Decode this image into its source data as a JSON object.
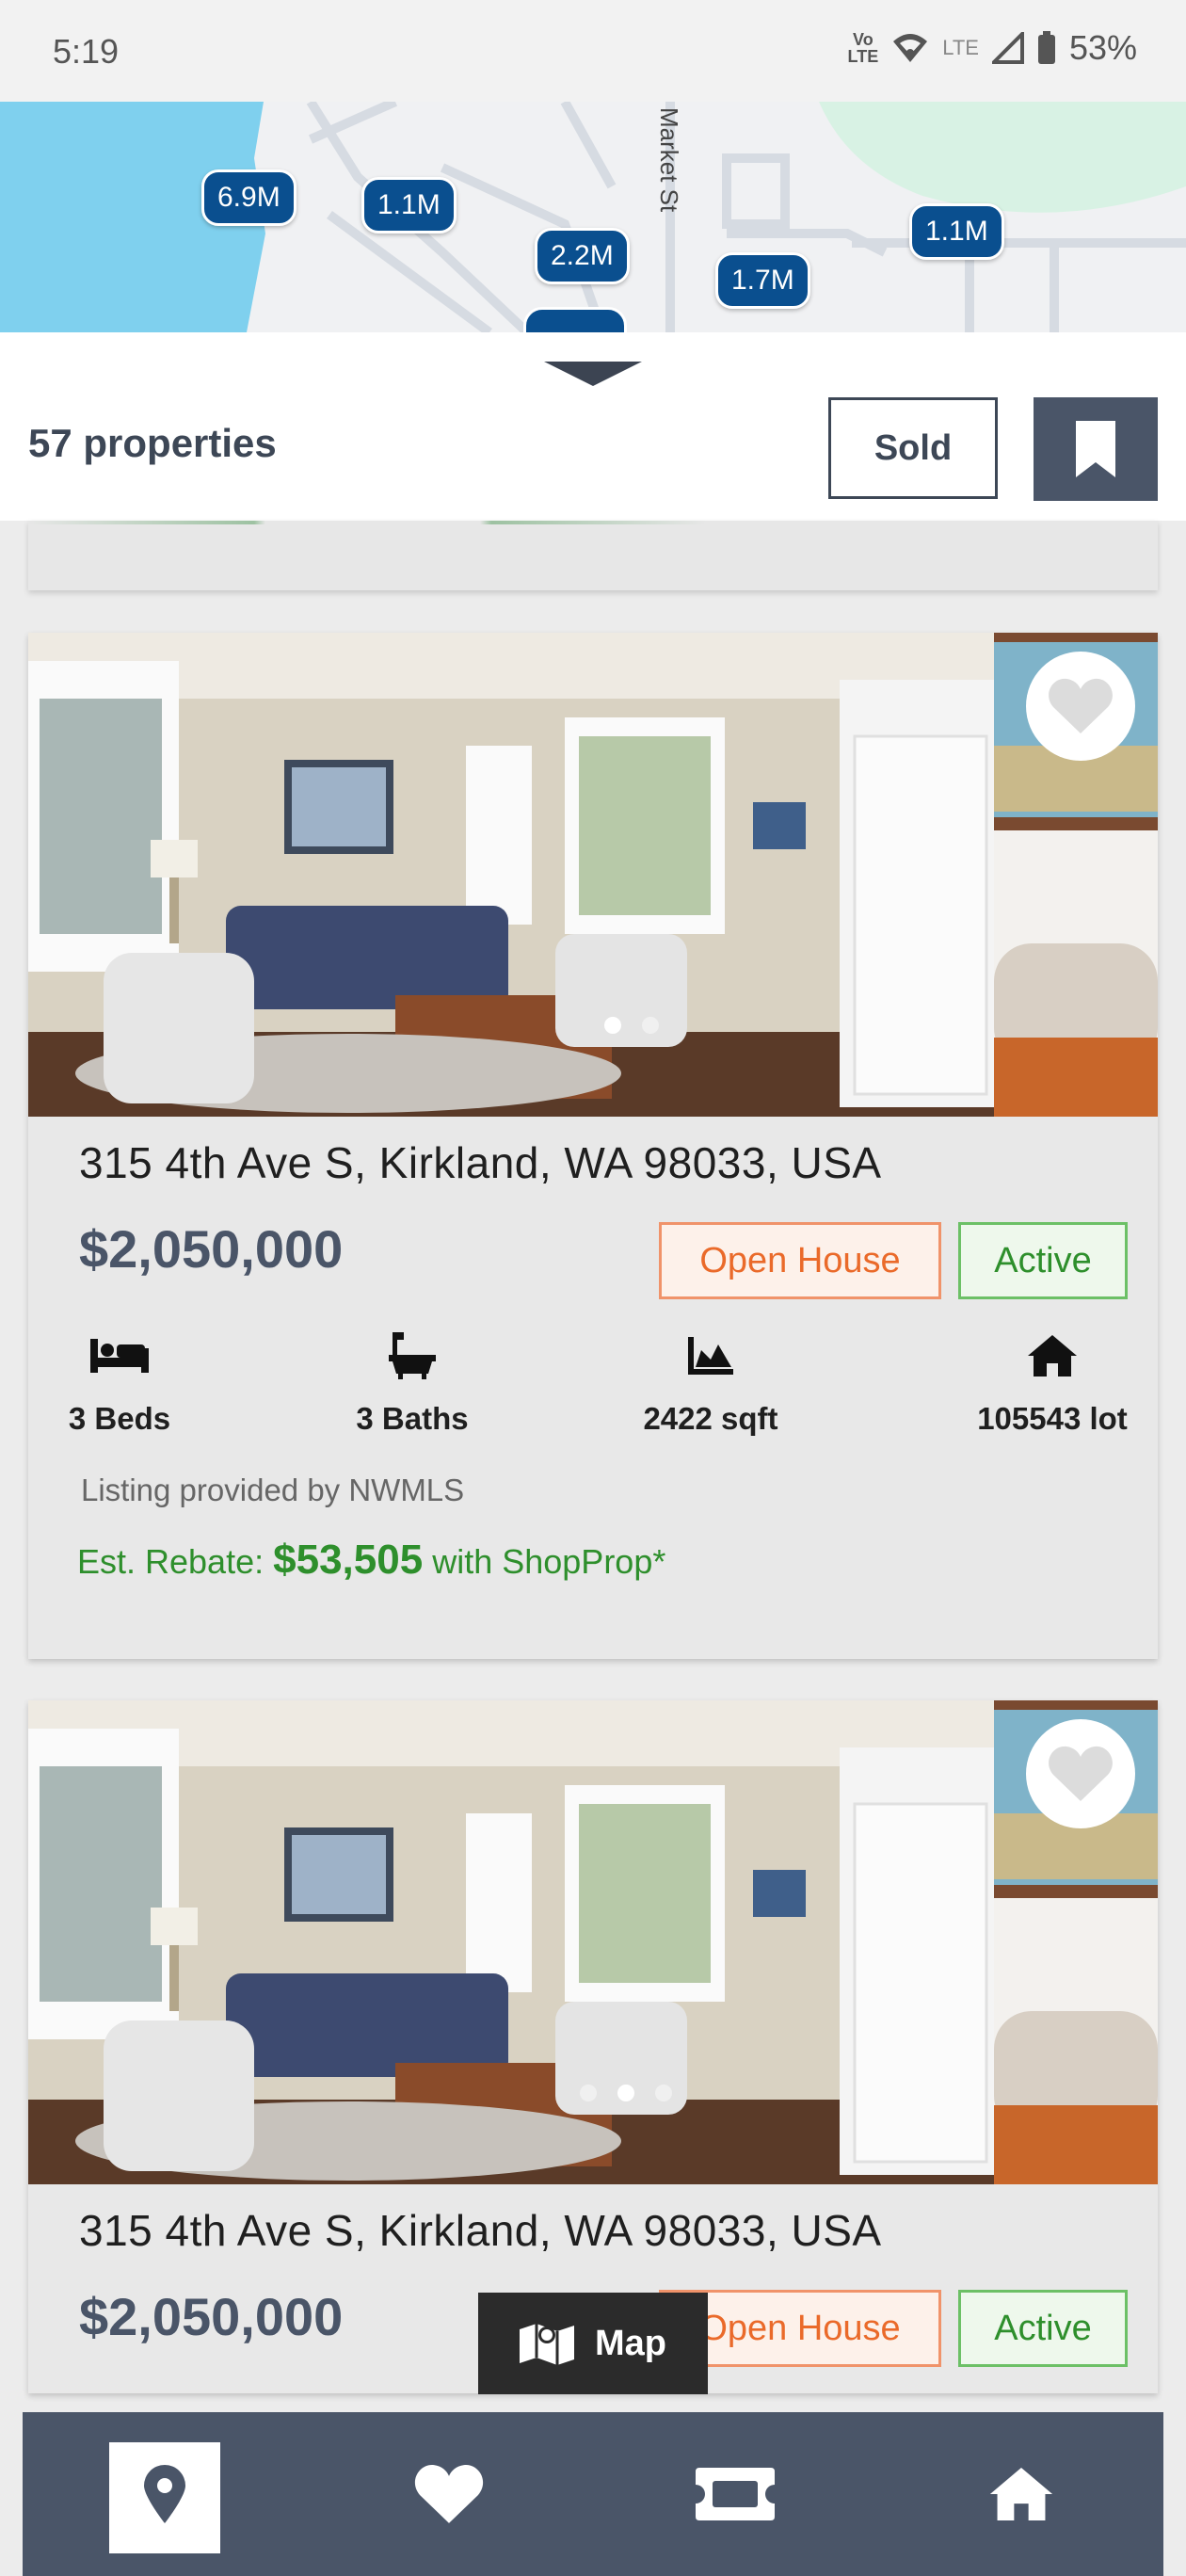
{
  "status_bar": {
    "time": "5:19",
    "volte_top": "Vo",
    "volte_bottom": "LTE",
    "network": "LTE",
    "battery": "53%"
  },
  "map": {
    "street_label": "Market St",
    "pins": [
      "6.9M",
      "1.1M",
      "2.2M",
      "1.7M",
      "1.1M"
    ]
  },
  "list_header": {
    "count_text": "57 properties",
    "sold_label": "Sold"
  },
  "listings": [
    {
      "address": "315 4th Ave S, Kirkland, WA 98033, USA",
      "price": "$2,050,000",
      "badges": {
        "open_house": "Open House",
        "status": "Active"
      },
      "features": {
        "beds": "3 Beds",
        "baths": "3 Baths",
        "sqft": "2422 sqft",
        "lot": "105543 lot"
      },
      "provided_by": "Listing provided by NWMLS",
      "rebate": {
        "prefix": "Est. Rebate:",
        "amount": "$53,505",
        "suffix": "with ShopProp*"
      }
    },
    {
      "address": "315 4th Ave S, Kirkland, WA 98033, USA",
      "price": "$2,050,000",
      "badges": {
        "open_house": "Open House",
        "status": "Active"
      }
    }
  ],
  "map_button": {
    "label": "Map"
  },
  "bottom_nav": {
    "items": [
      "location-pin-icon",
      "heart-icon",
      "ticket-icon",
      "home-icon"
    ]
  },
  "colors": {
    "brand": "#4a5568",
    "pin_blue": "#0a4f8f",
    "open_house": "#ea6a2a",
    "active": "#2e8f2c"
  }
}
